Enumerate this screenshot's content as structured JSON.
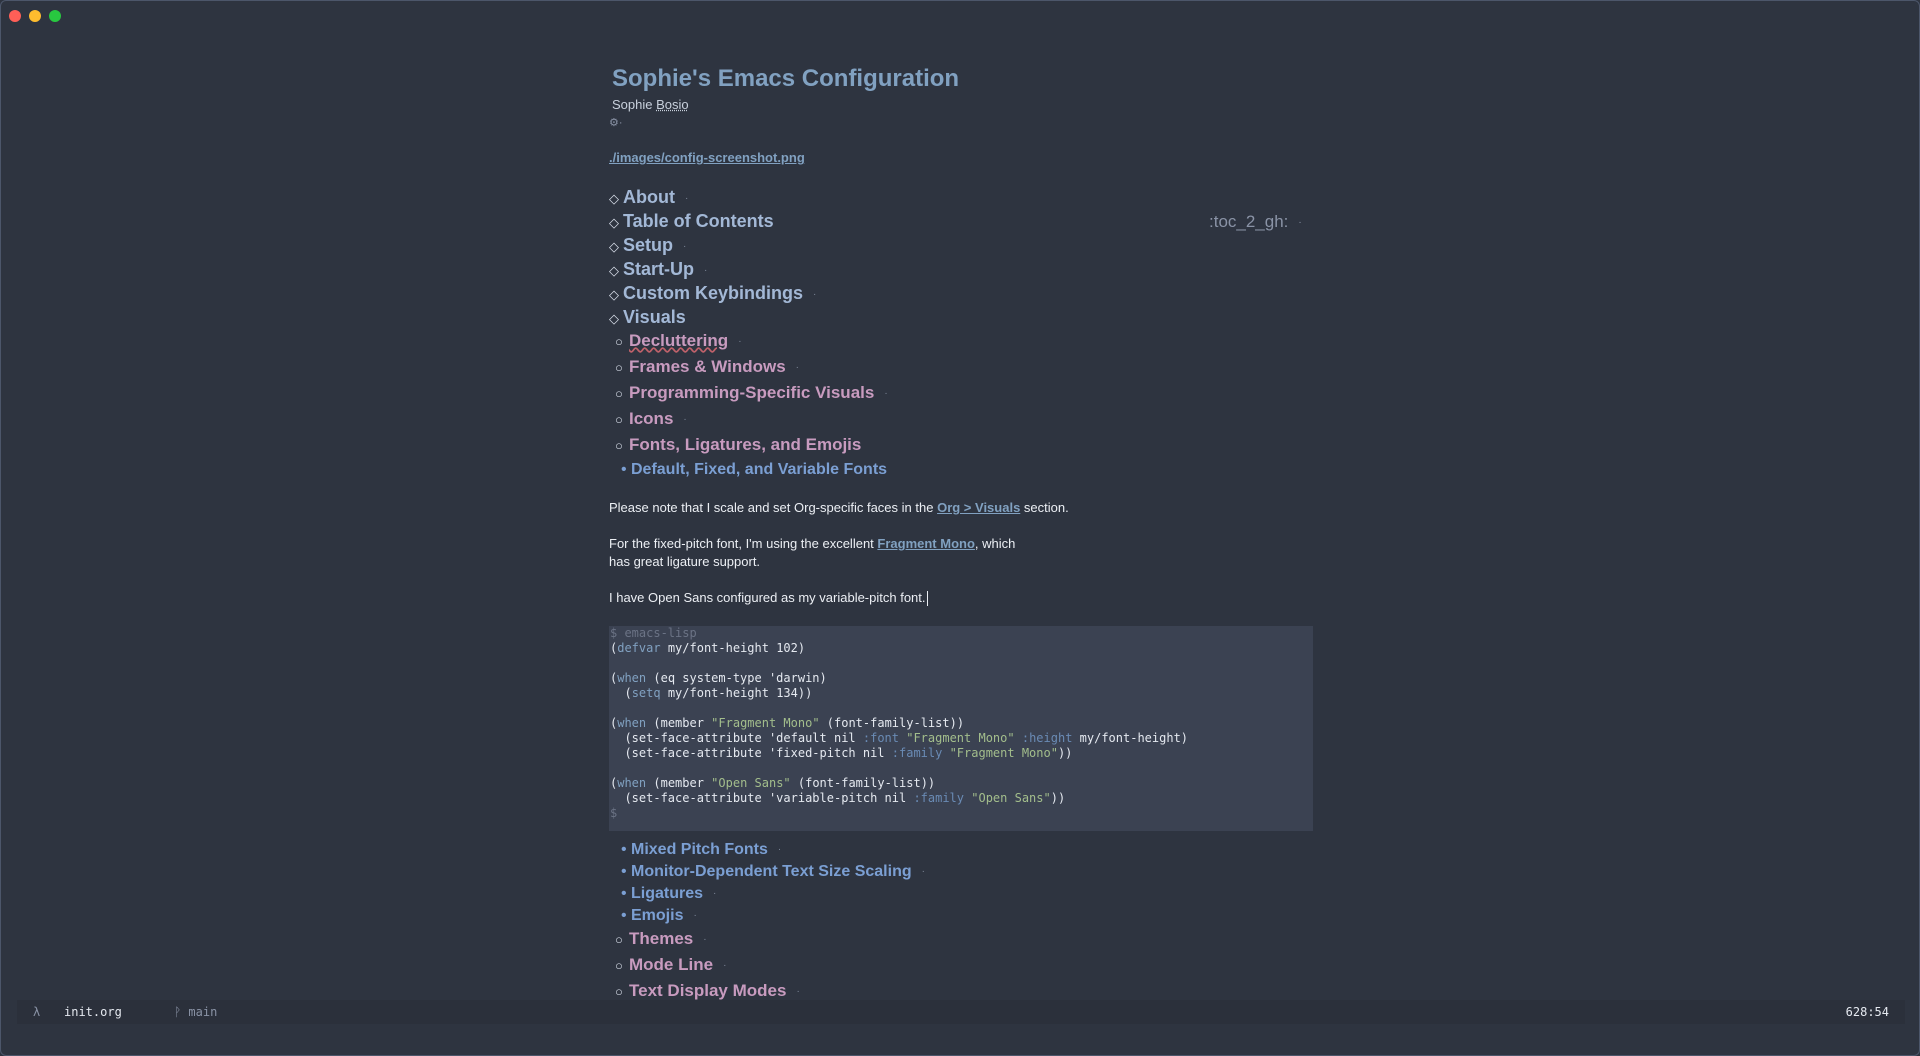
{
  "window": {
    "controls": [
      "close",
      "minimize",
      "maximize"
    ]
  },
  "document": {
    "title": "Sophie's Emacs Configuration",
    "author_first": "Sophie ",
    "author_last": "Bosio",
    "options_glyph": "⚙·",
    "image_link": "./images/config-screenshot.png",
    "headings_level1": [
      {
        "label": "About",
        "dot": "·"
      },
      {
        "label": "Table of Contents",
        "dot": ""
      },
      {
        "label": "Setup",
        "dot": "·"
      },
      {
        "label": "Start-Up",
        "dot": "·"
      },
      {
        "label": "Custom Keybindings",
        "dot": "·"
      },
      {
        "label": "Visuals",
        "dot": ""
      }
    ],
    "toc_tag": ":toc_2_gh:",
    "toc_tag_dot": "·",
    "visuals_subheadings": [
      {
        "label": "Decluttering",
        "dot": "·"
      },
      {
        "label": "Frames & Windows",
        "dot": "·"
      },
      {
        "label": "Programming-Specific Visuals",
        "dot": "·"
      },
      {
        "label": "Icons",
        "dot": "·"
      },
      {
        "label": "Fonts, Ligatures, and Emojis",
        "dot": ""
      }
    ],
    "fonts_subheading": "Default, Fixed, and Variable Fonts",
    "para1_before": "Please note that I scale and set Org-specific faces in the ",
    "para1_link": "Org > Visuals",
    "para1_after": " section.",
    "para2_before": "For the fixed-pitch font, I'm using the excellent ",
    "para2_link": "Fragment Mono",
    "para2_after": ", which",
    "para2_line2": "has great ligature support.",
    "para3": "I have Open Sans configured as my variable-pitch font.",
    "code_header": "$ emacs-lisp",
    "code_footer": "$",
    "more_fonts_subheadings": [
      {
        "label": "Mixed Pitch Fonts",
        "dot": "·"
      },
      {
        "label": "Monitor-Dependent Text Size Scaling",
        "dot": "·"
      },
      {
        "label": "Ligatures",
        "dot": "·"
      },
      {
        "label": "Emojis",
        "dot": "·"
      }
    ],
    "more_visuals_subheadings": [
      {
        "label": "Themes",
        "dot": "·"
      },
      {
        "label": "Mode Line",
        "dot": "·"
      },
      {
        "label": "Text Display Modes",
        "dot": "·"
      }
    ]
  },
  "code_lines": [
    [
      [
        "p",
        "("
      ],
      [
        "k",
        "defvar"
      ],
      [
        "p",
        " my/font-height 102)"
      ]
    ],
    [],
    [
      [
        "p",
        "("
      ],
      [
        "k",
        "when"
      ],
      [
        "p",
        " (eq system-type 'darwin)"
      ]
    ],
    [
      [
        "p",
        "  ("
      ],
      [
        "k",
        "setq"
      ],
      [
        "p",
        " my/font-height 134))"
      ]
    ],
    [],
    [
      [
        "p",
        "("
      ],
      [
        "k",
        "when"
      ],
      [
        "p",
        " (member "
      ],
      [
        "s",
        "\"Fragment Mono\""
      ],
      [
        "p",
        " (font-family-list))"
      ]
    ],
    [
      [
        "p",
        "  (set-face-attribute 'default nil "
      ],
      [
        "d",
        ":font"
      ],
      [
        "p",
        " "
      ],
      [
        "s",
        "\"Fragment Mono\""
      ],
      [
        "p",
        " "
      ],
      [
        "d",
        ":height"
      ],
      [
        "p",
        " my/font-height)"
      ]
    ],
    [
      [
        "p",
        "  (set-face-attribute 'fixed-pitch nil "
      ],
      [
        "d",
        ":family"
      ],
      [
        "p",
        " "
      ],
      [
        "s",
        "\"Fragment Mono\""
      ],
      [
        "p",
        "))"
      ]
    ],
    [],
    [
      [
        "p",
        "("
      ],
      [
        "k",
        "when"
      ],
      [
        "p",
        " (member "
      ],
      [
        "s",
        "\"Open Sans\""
      ],
      [
        "p",
        " (font-family-list))"
      ]
    ],
    [
      [
        "p",
        "  (set-face-attribute 'variable-pitch nil "
      ],
      [
        "d",
        ":family"
      ],
      [
        "p",
        " "
      ],
      [
        "s",
        "\"Open Sans\""
      ],
      [
        "p",
        "))"
      ]
    ]
  ],
  "statusbar": {
    "lambda": "λ",
    "filename": "init.org",
    "branch": "ᚹ main",
    "position": "628:54"
  }
}
